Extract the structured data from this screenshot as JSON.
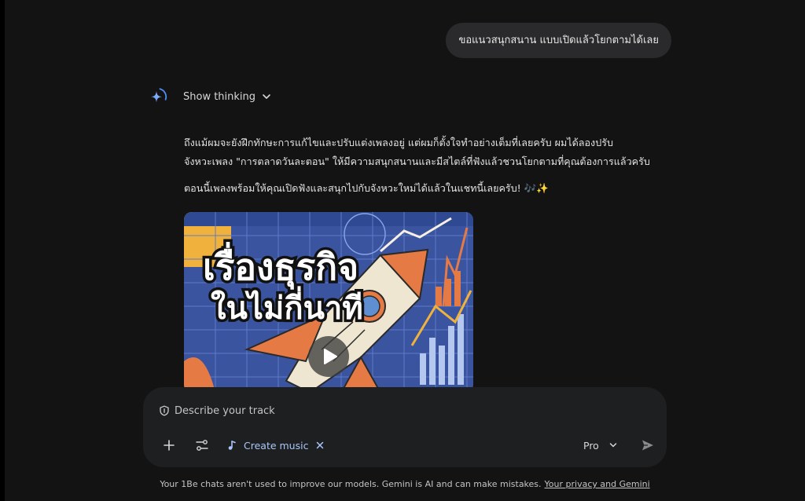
{
  "user_message": "ขอแนวสนุกสนาน แบบเปิดแล้วโยกตามได้เลย",
  "thinking": {
    "label": "Show thinking"
  },
  "response": {
    "paragraph1_line1": "ถึงแม้ผมจะยังฝึกทักษะการแก้ไขและปรับแต่งเพลงอยู่ แต่ผมก็ตั้งใจทำอย่างเต็มที่เลยครับ ผมได้ลองปรับ",
    "paragraph1_line2": "จังหวะเพลง \"การตลาดวันละตอน\" ให้มีความสนุกสนานและมีสไตล์ที่ฟังแล้วชวนโยกตามที่คุณต้องการแล้วครับ",
    "paragraph2": "ตอนนี้เพลงพร้อมให้คุณเปิดฟังและสนุกไปกับจังหวะใหม่ได้แล้วในแชทนี้เลยครับ! 🎶✨"
  },
  "video": {
    "title_line1": "เรื่องธุรกิจ",
    "title_line2": "ในไม่กี่นาที"
  },
  "composer": {
    "placeholder": "Describe your track",
    "chip_label": "Create music",
    "model_label": "Pro"
  },
  "footer": {
    "text": "Your 1Be chats aren't used to improve our models. Gemini is AI and can make mistakes.",
    "link": "Your privacy and Gemini"
  },
  "icons": {
    "thinking": "gemini-sparkle-icon",
    "chevron": "chevron-down-icon",
    "shield": "shield-icon",
    "add": "plus-icon",
    "tools": "tools-icon",
    "music": "music-note-icon",
    "remove": "close-icon",
    "send": "send-icon",
    "play": "play-icon"
  },
  "colors": {
    "background": "#131314",
    "bubble": "#2a2a2c",
    "composer": "#1e1f20",
    "accent": "#a8c7fa"
  }
}
